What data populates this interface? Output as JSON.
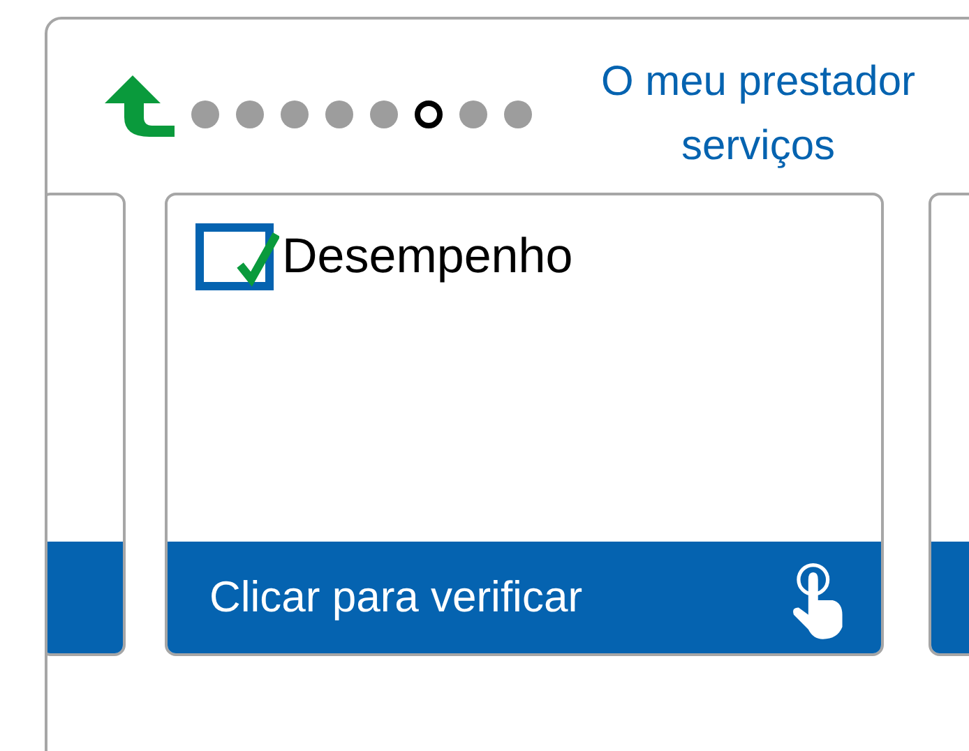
{
  "header": {
    "page_dots": [
      {
        "selected": false
      },
      {
        "selected": false
      },
      {
        "selected": false
      },
      {
        "selected": false
      },
      {
        "selected": false
      },
      {
        "selected": true
      },
      {
        "selected": false
      },
      {
        "selected": false
      }
    ],
    "title_lines": [
      "O meu prestador",
      "serviços"
    ]
  },
  "cards": [
    {
      "kind": "partial"
    },
    {
      "kind": "full",
      "checked": true,
      "title": "Desempenho",
      "action": "Clicar para verificar"
    },
    {
      "kind": "partial"
    }
  ]
}
